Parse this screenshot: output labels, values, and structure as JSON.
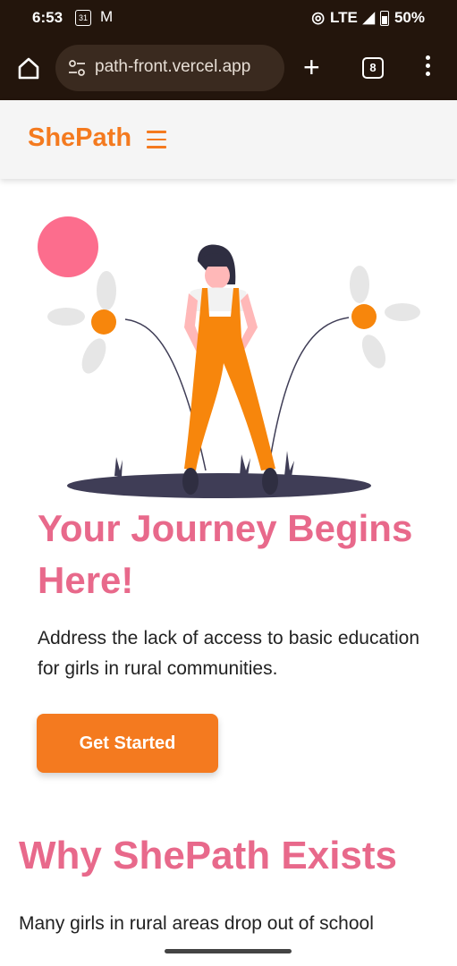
{
  "status_bar": {
    "time": "6:53",
    "calendar_day": "31",
    "network": "LTE",
    "battery": "50%"
  },
  "browser": {
    "url": "path-front.vercel.app",
    "tab_count": "8"
  },
  "site": {
    "brand": "ShePath",
    "brand_color": "#f47a1f",
    "accent_color": "#e8698b"
  },
  "hero": {
    "title": "Your Journey Begins Here!",
    "description": "Address the lack of access to basic education for girls in rural communities.",
    "cta_label": "Get Started"
  },
  "why": {
    "title": "Why ShePath Exists",
    "text": "Many girls in rural areas drop out of school"
  }
}
